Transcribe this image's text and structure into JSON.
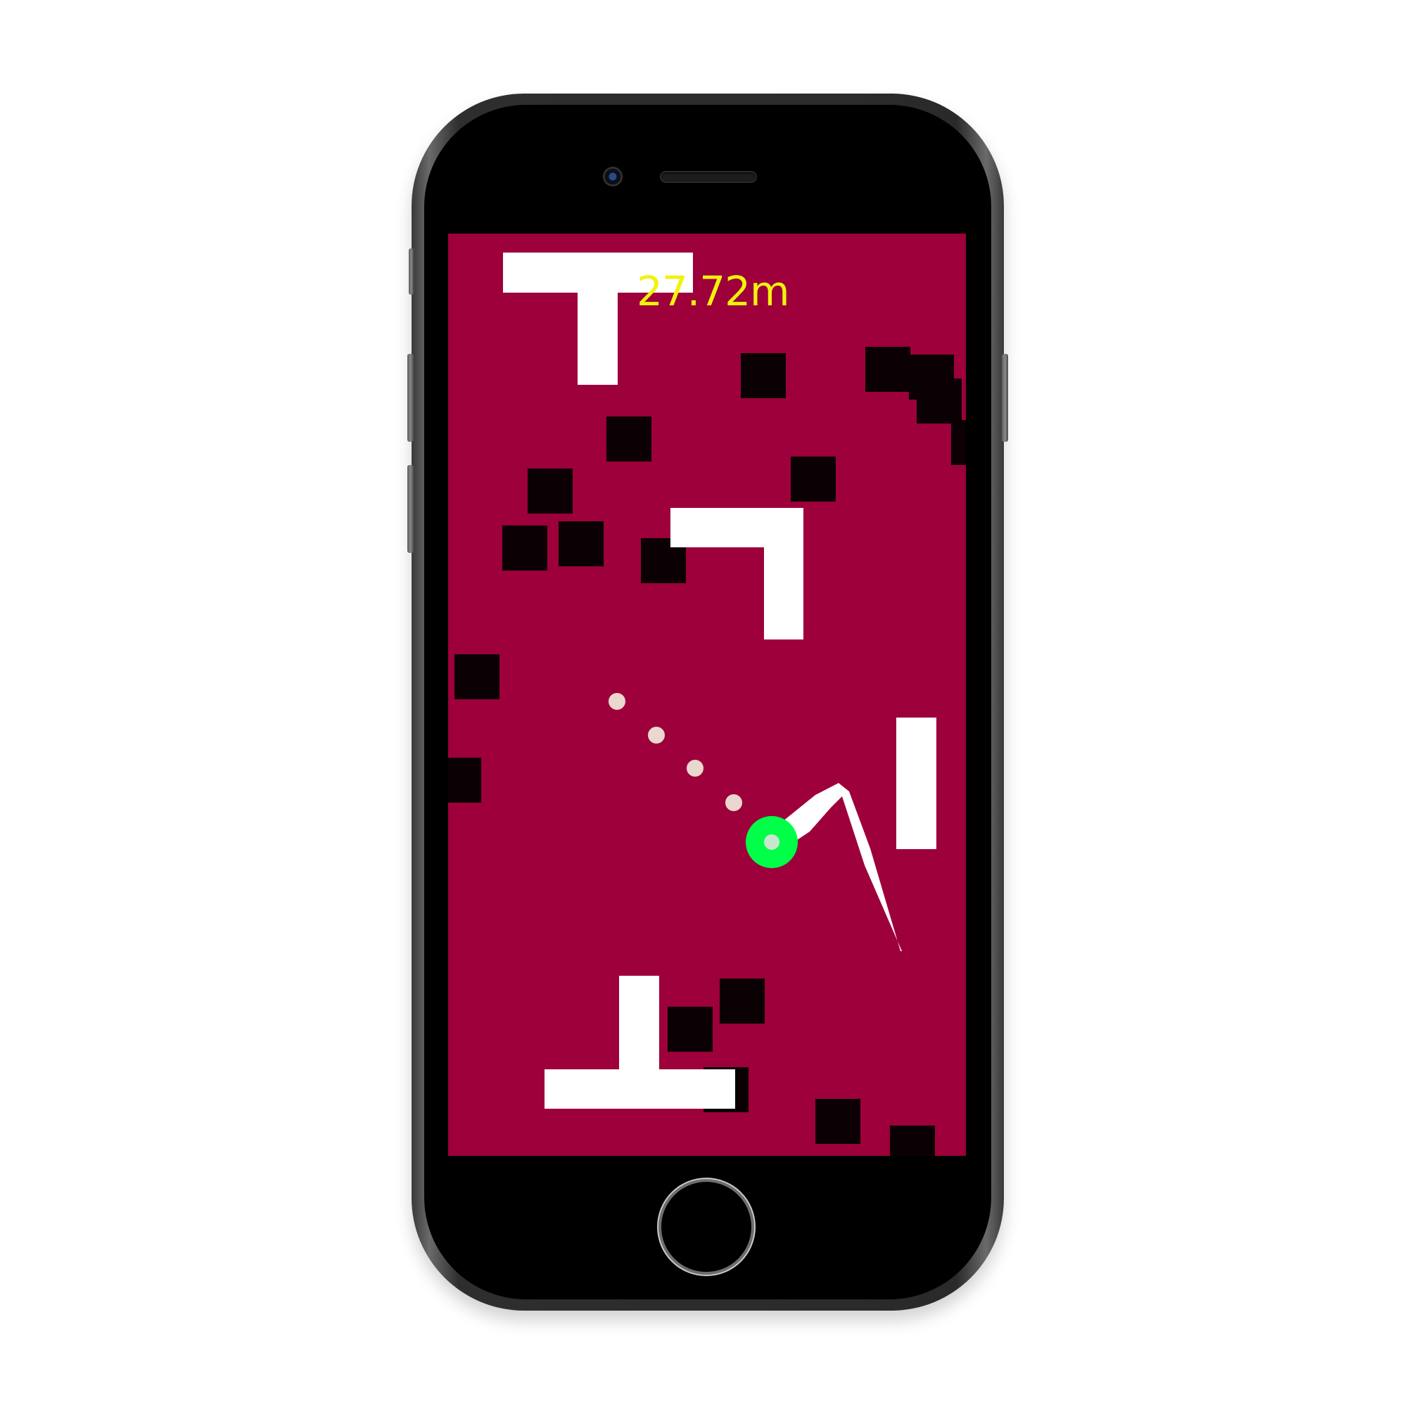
{
  "hud": {
    "distance": "27.72m"
  },
  "colors": {
    "background": "#9d003a",
    "white_block": "#ffffff",
    "dark_block": "#0b0003",
    "player": "#00ff48",
    "player_core": "#c8e6cf",
    "trajectory_dot": "#ead8cf",
    "distance_text": "#f2f20f"
  },
  "icons": {
    "player": "green-ring-ball",
    "trail": "white-rope-trail"
  }
}
